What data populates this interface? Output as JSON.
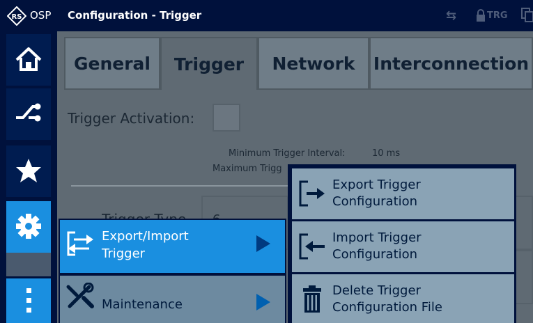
{
  "topbar": {
    "app_name": "OSP",
    "window_title": "Configuration - Trigger",
    "status_trg": "TRG"
  },
  "nav": {
    "items": [
      "home-icon",
      "connection-icon",
      "favorites-icon",
      "settings-icon",
      "more-icon"
    ],
    "active": "settings-icon"
  },
  "tabs": [
    {
      "label": "General"
    },
    {
      "label": "Trigger"
    },
    {
      "label": "Network"
    },
    {
      "label": "Interconnection"
    }
  ],
  "trigger": {
    "activation_label": "Trigger Activation:",
    "min_interval_label": "Minimum Trigger Interval:",
    "min_interval_value": "10 ms",
    "max_label_partial": "Maximum Trigg",
    "type_label_partial": "Trigger Type",
    "type_value_partial": "6"
  },
  "menu": {
    "items": [
      {
        "label_line1": "Export/Import",
        "label_line2": "Trigger",
        "icon": "export-import-icon"
      },
      {
        "label_line1": "Maintenance",
        "label_line2": "",
        "icon": "tools-icon"
      }
    ]
  },
  "submenu": {
    "items": [
      {
        "label_line1": "Export Trigger",
        "label_line2": "Configuration",
        "icon": "export-icon"
      },
      {
        "label_line1": "Import Trigger",
        "label_line2": "Configuration",
        "icon": "import-icon"
      },
      {
        "label_line1": "Delete Trigger",
        "label_line2": "Configuration File",
        "icon": "trash-icon"
      }
    ]
  },
  "colors": {
    "navy": "#00113c",
    "accent": "#1a8fe0",
    "menu_bg": "#6d8aa0",
    "submenu_bg": "#8aa3b5"
  }
}
